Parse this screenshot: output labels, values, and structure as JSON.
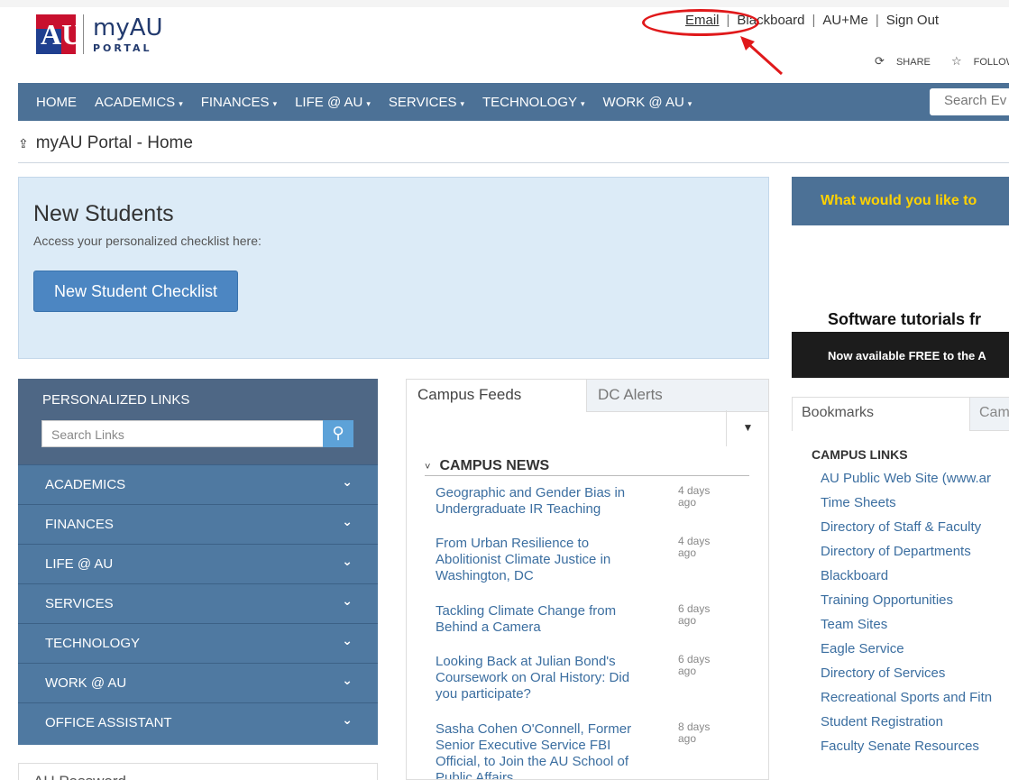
{
  "header": {
    "logo_letters": "AU",
    "logo_big": "myAU",
    "logo_small": "PORTAL",
    "links": [
      {
        "label": "Email"
      },
      {
        "label": "Blackboard"
      },
      {
        "label": "AU+Me"
      },
      {
        "label": "Sign Out"
      }
    ],
    "share_label": "SHARE",
    "follow_label": "FOLLOW"
  },
  "nav": {
    "items": [
      {
        "label": "HOME",
        "caret": ""
      },
      {
        "label": "ACADEMICS",
        "caret": "▾"
      },
      {
        "label": "FINANCES",
        "caret": "▾"
      },
      {
        "label": "LIFE @ AU",
        "caret": "▾"
      },
      {
        "label": "SERVICES",
        "caret": "▾"
      },
      {
        "label": "TECHNOLOGY",
        "caret": "▾"
      },
      {
        "label": "WORK @ AU",
        "caret": "▾"
      }
    ],
    "search_placeholder": "Search Ev"
  },
  "breadcrumb": "myAU Portal - Home",
  "new_students": {
    "title": "New Students",
    "subtitle": "Access your personalized checklist here:",
    "button": "New Student Checklist"
  },
  "promo": {
    "headline": "What would you like to",
    "subheading": "Software tutorials fr",
    "banner": "Now available FREE to the A"
  },
  "personalized_links": {
    "title": "PERSONALIZED LINKS",
    "search_placeholder": "Search Links",
    "sections": [
      "ACADEMICS",
      "FINANCES",
      "LIFE @ AU",
      "SERVICES",
      "TECHNOLOGY",
      "WORK @ AU",
      "OFFICE ASSISTANT"
    ]
  },
  "au_password": "AU Password",
  "feeds": {
    "tabs": [
      "Campus Feeds",
      "DC Alerts"
    ],
    "section_title": "CAMPUS NEWS",
    "news": [
      {
        "title": "Geographic and Gender Bias in Undergraduate IR Teaching",
        "date": "4 days ago"
      },
      {
        "title": "From Urban Resilience to Abolitionist Climate Justice in Washington, DC",
        "date": "4 days ago"
      },
      {
        "title": "Tackling Climate Change from Behind a Camera",
        "date": "6 days ago"
      },
      {
        "title": "Looking Back at Julian Bond's Coursework on Oral History: Did you participate?",
        "date": "6 days ago"
      },
      {
        "title": "Sasha Cohen O'Connell, Former Senior Executive Service FBI Official, to Join the AU School of Public Affairs",
        "date": "8 days ago"
      }
    ]
  },
  "bookmarks": {
    "tabs": [
      "Bookmarks",
      "Cam"
    ],
    "section_title": "CAMPUS LINKS",
    "links": [
      "AU Public Web Site (www.ar",
      "Time Sheets",
      "Directory of Staff & Faculty",
      "Directory of Departments",
      "Blackboard",
      "Training Opportunities",
      "Team Sites",
      "Eagle Service",
      "Directory of Services",
      "Recreational Sports and Fitn",
      "Student Registration",
      "Faculty Senate Resources"
    ]
  },
  "annotation_color": "#e0191b"
}
